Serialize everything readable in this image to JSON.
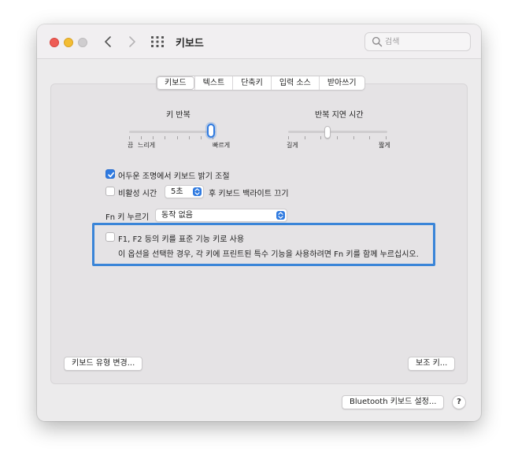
{
  "window": {
    "title": "키보드",
    "search_placeholder": "검색"
  },
  "tabs": [
    {
      "label": "키보드",
      "active": true
    },
    {
      "label": "텍스트",
      "active": false
    },
    {
      "label": "단축키",
      "active": false
    },
    {
      "label": "입력 소스",
      "active": false
    },
    {
      "label": "받아쓰기",
      "active": false
    }
  ],
  "key_repeat": {
    "title": "키 반복",
    "left_label": "끔",
    "slow_label": "느리게",
    "fast_label": "빠르게",
    "level": 1.0
  },
  "repeat_delay": {
    "title": "반복 지연 시간",
    "long_label": "길게",
    "short_label": "짧게",
    "level": 0.4
  },
  "options": {
    "adjust_brightness": {
      "label": "어두운 조명에서 키보드 밝기 조절",
      "checked": true
    },
    "backlight_off": {
      "label_before": "비활성 시간",
      "value": "5초",
      "label_after": "후 키보드 백라이트 끄기",
      "checked": false
    }
  },
  "fn_key": {
    "label": "Fn 키 누르기",
    "value": "동작 없음"
  },
  "function_keys": {
    "label": "F1, F2 등의 키를 표준 기능 키로 사용",
    "checked": false,
    "description": "이 옵션을 선택한 경우, 각 키에 프린트된 특수 기능을 사용하려면 Fn 키를 함께 누르십시오."
  },
  "buttons": {
    "change_type": "키보드 유형 변경...",
    "modifier": "보조 키...",
    "bluetooth": "Bluetooth 키보드 설정...",
    "help": "?"
  },
  "colors": {
    "accent": "#2f7ae0",
    "highlight_box": "#3a85d8"
  }
}
